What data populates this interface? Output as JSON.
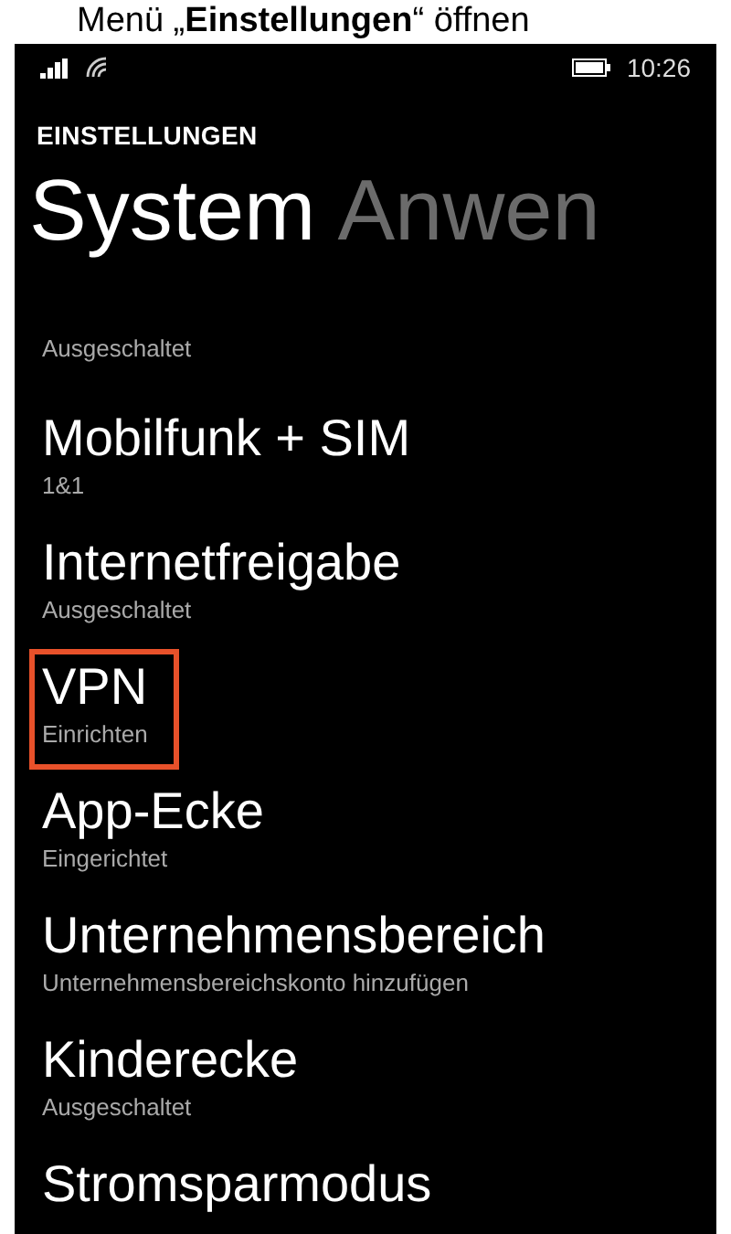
{
  "caption": "Menü „**Einstellungen**“ öffnen",
  "status_bar": {
    "time": "10:26"
  },
  "app_title": "EINSTELLUNGEN",
  "pivot": [
    {
      "label": "System",
      "selected": true
    },
    {
      "label": "Anwen",
      "selected": false
    }
  ],
  "items": [
    {
      "subtitle": "Ausgeschaltet",
      "highlighted": false
    },
    {
      "title": "Mobilfunk + SIM",
      "subtitle": "1&1",
      "highlighted": false
    },
    {
      "title": "Internetfreigabe",
      "subtitle": "Ausgeschaltet",
      "highlighted": false
    },
    {
      "title": "VPN",
      "subtitle": "Einrichten",
      "highlighted": true
    },
    {
      "title": "App-Ecke",
      "subtitle": "Eingerichtet",
      "highlighted": false
    },
    {
      "title": "Unternehmensbereich",
      "subtitle": "Unternehmensbereichskonto hinzufügen",
      "highlighted": false
    },
    {
      "title": "Kinderecke",
      "subtitle": "Ausgeschaltet",
      "highlighted": false
    },
    {
      "title": "Stromsparmodus",
      "highlighted": false
    }
  ]
}
